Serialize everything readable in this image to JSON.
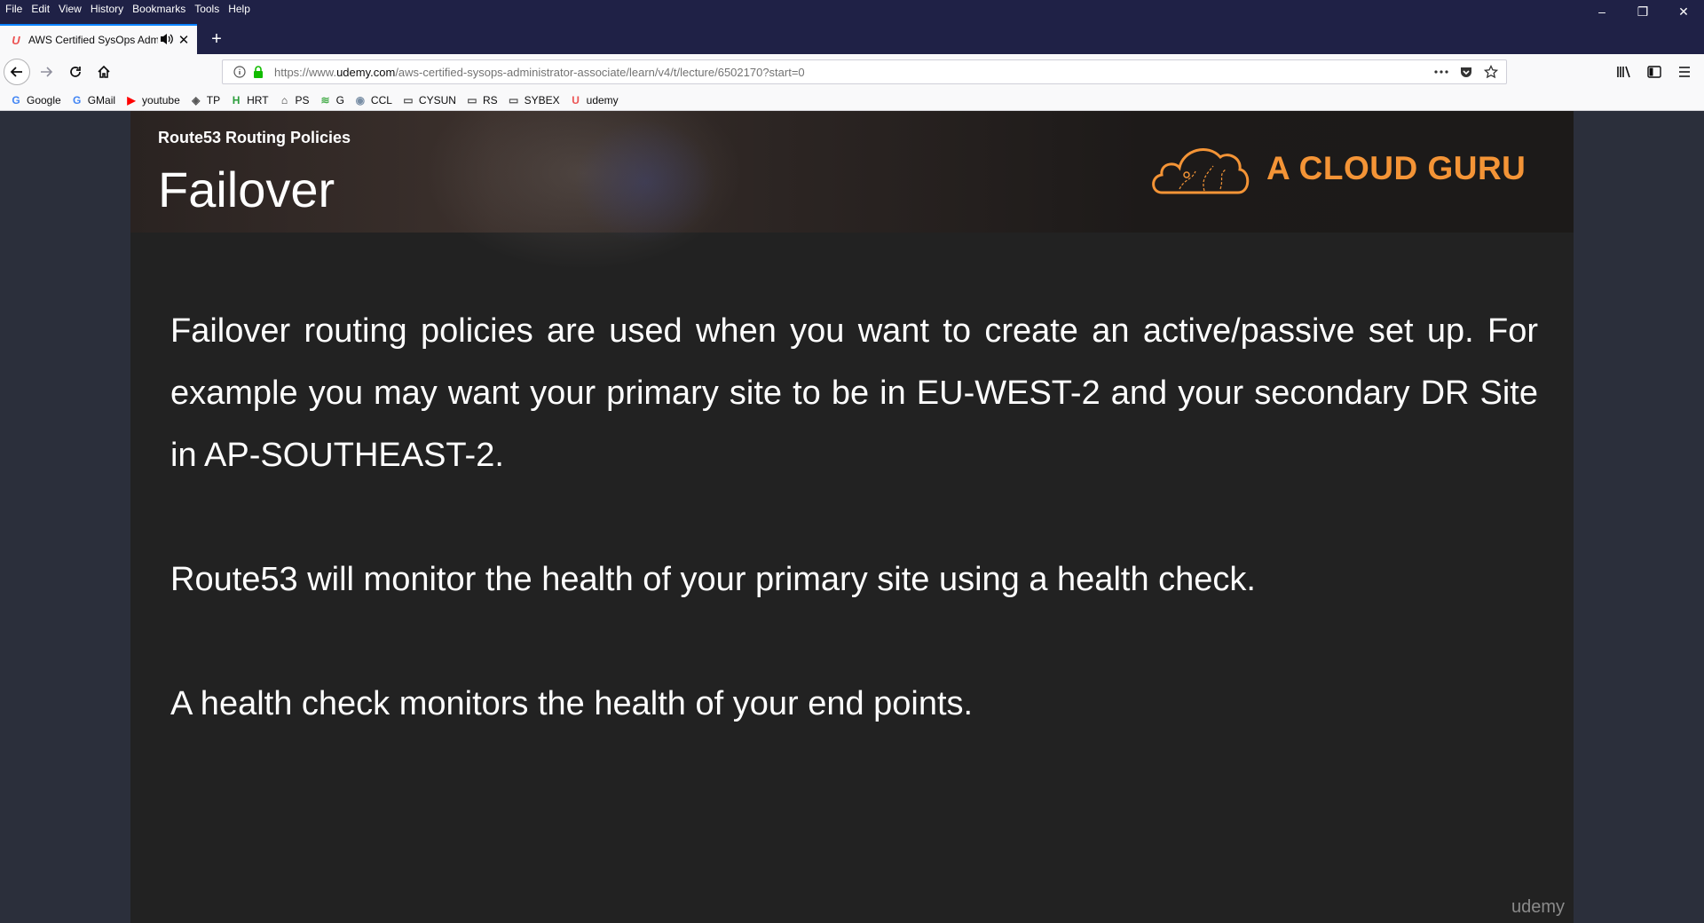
{
  "menu": [
    "File",
    "Edit",
    "View",
    "History",
    "Bookmarks",
    "Tools",
    "Help"
  ],
  "window_controls": {
    "minimize": "–",
    "restore": "❐",
    "close": "✕"
  },
  "tab": {
    "title": "AWS Certified SysOps Admi",
    "favicon": "udemy-icon",
    "close": "✕"
  },
  "new_tab": "+",
  "url": {
    "prefix": "https://www.",
    "domain": "udemy.com",
    "path": "/aws-certified-sysops-administrator-associate/learn/v4/t/lecture/6502170?start=0"
  },
  "bookmarks": [
    {
      "label": "Google",
      "icon": "G",
      "color": "#4285f4"
    },
    {
      "label": "GMail",
      "icon": "G",
      "color": "#4285f4"
    },
    {
      "label": "youtube",
      "icon": "▶",
      "color": "#ff0000"
    },
    {
      "label": "TP",
      "icon": "◈",
      "color": "#555555"
    },
    {
      "label": "HRT",
      "icon": "H",
      "color": "#2a9d3a"
    },
    {
      "label": "PS",
      "icon": "⌂",
      "color": "#333333"
    },
    {
      "label": "G",
      "icon": "≋",
      "color": "#4caf50"
    },
    {
      "label": "CCL",
      "icon": "◉",
      "color": "#7a8fa6"
    },
    {
      "label": "CYSUN",
      "icon": "▭",
      "color": "#555555"
    },
    {
      "label": "RS",
      "icon": "▭",
      "color": "#555555"
    },
    {
      "label": "SYBEX",
      "icon": "▭",
      "color": "#555555"
    },
    {
      "label": "udemy",
      "icon": "U",
      "color": "#ec5252"
    }
  ],
  "slide": {
    "section": "Route53 Routing Policies",
    "title": "Failover",
    "brand": "A CLOUD GURU",
    "paragraphs": [
      "Failover routing policies are used when you want to create an active/passive set up. For example you may want your primary site to be in EU-WEST-2 and your secondary DR Site in AP-SOUTHEAST-2.",
      "Route53 will monitor the health of your primary site using a health check.",
      "A health check monitors the health of your end points."
    ],
    "watermark": "udemy"
  },
  "colors": {
    "accent": "#f49436",
    "chrome_dark": "#1f2146",
    "tab_highlight": "#0a84ff",
    "lock_green": "#12bc00"
  }
}
